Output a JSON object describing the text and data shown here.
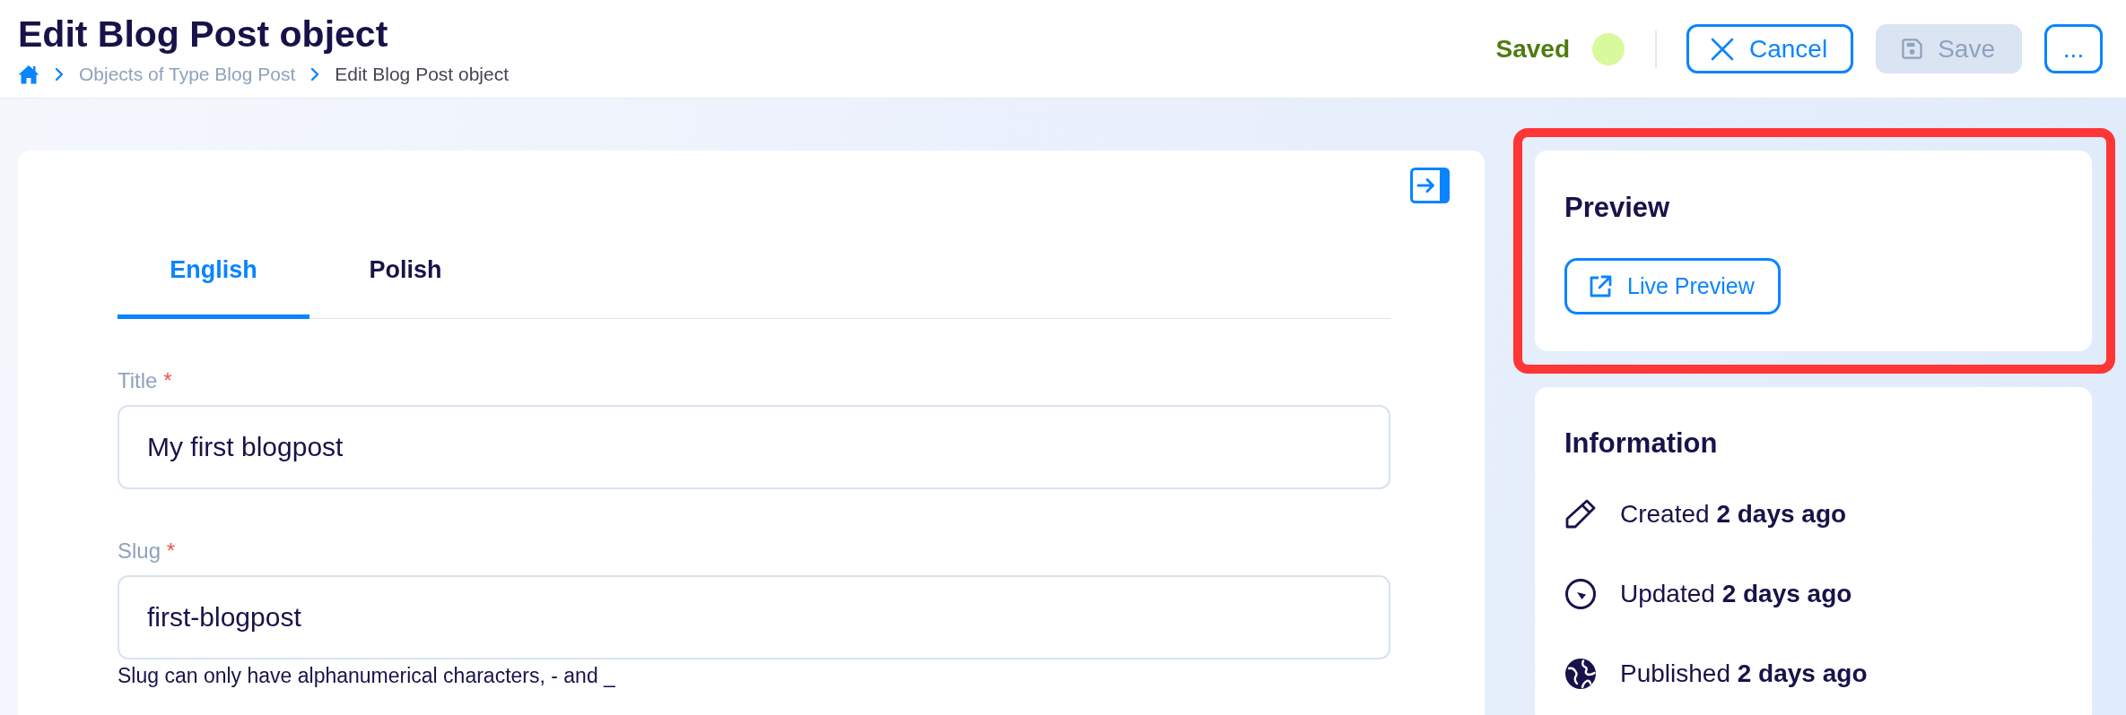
{
  "header": {
    "title": "Edit Blog Post object",
    "breadcrumb": [
      {
        "kind": "home"
      },
      {
        "kind": "link",
        "label": "Objects of Type Blog Post"
      },
      {
        "kind": "current",
        "label": "Edit Blog Post object"
      }
    ],
    "status": {
      "kind": "saved",
      "label": "Saved"
    },
    "actions": [
      {
        "kind": "cancel",
        "label": "Cancel",
        "disabled": false
      },
      {
        "kind": "save",
        "label": "Save",
        "disabled": true
      },
      {
        "kind": "more",
        "label": "...",
        "disabled": false
      }
    ]
  },
  "editor": {
    "tabs": [
      {
        "label": "English",
        "selected": true
      },
      {
        "label": "Polish",
        "selected": false
      }
    ],
    "fields": [
      {
        "label": "Title",
        "required_mark": "*",
        "value": "My first blogpost"
      },
      {
        "label": "Slug",
        "required_mark": "*",
        "value": "first-blogpost",
        "hint": "Slug can only have alphanumerical characters, - and _"
      }
    ]
  },
  "preview": {
    "title": "Preview",
    "highlighted": true,
    "button": "Live Preview"
  },
  "information": {
    "title": "Information",
    "items": [
      {
        "kind": "created",
        "text": "Created **2 days ago**"
      },
      {
        "kind": "updated",
        "text": "Updated **2 days ago**"
      },
      {
        "kind": "published",
        "text": "Published **2 days ago**"
      }
    ]
  }
}
